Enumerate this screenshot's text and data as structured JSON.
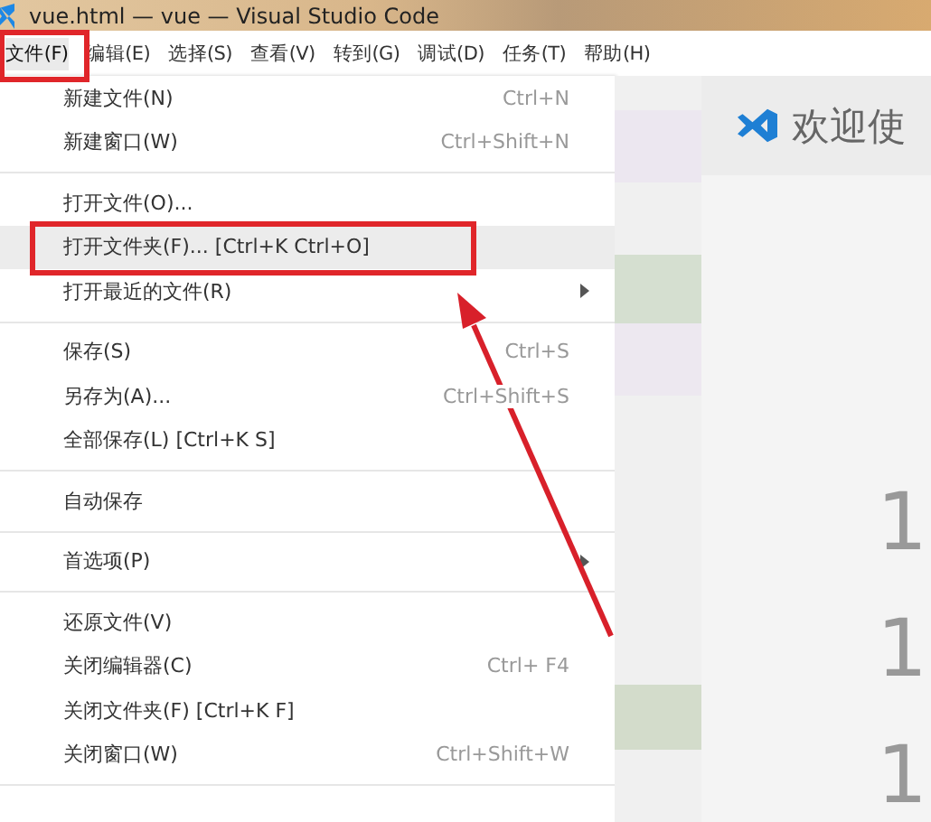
{
  "window": {
    "title": "vue.html — vue — Visual Studio Code"
  },
  "menu_bar": [
    {
      "label": "文件(F)",
      "selected": true
    },
    {
      "label": "编辑(E)",
      "selected": false
    },
    {
      "label": "选择(S)",
      "selected": false
    },
    {
      "label": "查看(V)",
      "selected": false
    },
    {
      "label": "转到(G)",
      "selected": false
    },
    {
      "label": "调试(D)",
      "selected": false
    },
    {
      "label": "任务(T)",
      "selected": false
    },
    {
      "label": "帮助(H)",
      "selected": false
    }
  ],
  "file_menu": [
    {
      "kind": "item",
      "label": "新建文件(N)",
      "shortcut": "Ctrl+N",
      "submenu": false,
      "selected": false
    },
    {
      "kind": "item",
      "label": "新建窗口(W)",
      "shortcut": "Ctrl+Shift+N",
      "submenu": false,
      "selected": false
    },
    {
      "kind": "separator"
    },
    {
      "kind": "item",
      "label": "打开文件(O)...",
      "submenu": false,
      "selected": false
    },
    {
      "kind": "item",
      "label": "打开文件夹(F)... [Ctrl+K Ctrl+O]",
      "submenu": false,
      "selected": true
    },
    {
      "kind": "item",
      "label": "打开最近的文件(R)",
      "submenu": true,
      "selected": false
    },
    {
      "kind": "separator"
    },
    {
      "kind": "item",
      "label": "保存(S)",
      "shortcut": "Ctrl+S",
      "submenu": false,
      "selected": false
    },
    {
      "kind": "item",
      "label": "另存为(A)...",
      "shortcut": "Ctrl+Shift+S",
      "submenu": false,
      "selected": false
    },
    {
      "kind": "item",
      "label": "全部保存(L) [Ctrl+K S]",
      "submenu": false,
      "selected": false
    },
    {
      "kind": "separator"
    },
    {
      "kind": "item",
      "label": "自动保存",
      "submenu": false,
      "selected": false
    },
    {
      "kind": "separator"
    },
    {
      "kind": "item",
      "label": "首选项(P)",
      "submenu": true,
      "selected": false
    },
    {
      "kind": "separator"
    },
    {
      "kind": "item",
      "label": "还原文件(V)",
      "submenu": false,
      "selected": false
    },
    {
      "kind": "item",
      "label": "关闭编辑器(C)",
      "shortcut": "Ctrl+ F4",
      "submenu": false,
      "selected": false
    },
    {
      "kind": "item",
      "label": "关闭文件夹(F) [Ctrl+K F]",
      "submenu": false,
      "selected": false
    },
    {
      "kind": "item",
      "label": "关闭窗口(W)",
      "shortcut": "Ctrl+Shift+W",
      "submenu": false,
      "selected": false
    },
    {
      "kind": "separator"
    }
  ],
  "editor": {
    "tab": {
      "title": "欢迎使"
    },
    "line_numbers": [
      "1",
      "1",
      "1"
    ]
  }
}
